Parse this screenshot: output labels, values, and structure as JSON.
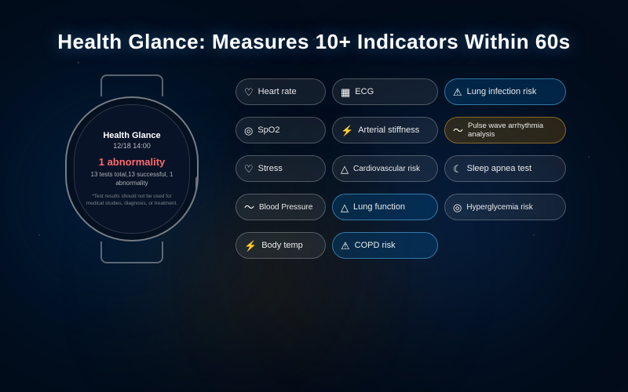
{
  "page": {
    "title": "Health Glance: Measures 10+ Indicators Within 60s"
  },
  "watch": {
    "screen_title": "Health Glance",
    "screen_date": "12/18 14:00",
    "abnormality_text": "1 abnormality",
    "count_text": "13 tests total,13 successful, 1\nabnormality",
    "disclaimer": "*Test results should not be\nused for medical studies,\ndiagnosis, or treatment."
  },
  "indicators": [
    {
      "id": "heart-rate",
      "icon": "♡",
      "label": "Heart rate",
      "style": "normal",
      "col": 1,
      "row": 1
    },
    {
      "id": "ecg",
      "icon": "📋",
      "label": "ECG",
      "style": "normal",
      "col": 2,
      "row": 1
    },
    {
      "id": "lung-infection",
      "icon": "⚠",
      "label": "Lung infection risk",
      "style": "highlighted",
      "col": 3,
      "row": 1
    },
    {
      "id": "spo2",
      "icon": "◎",
      "label": "SpO2",
      "style": "normal",
      "col": 1,
      "row": 2
    },
    {
      "id": "arterial-stiffness",
      "icon": "⚡",
      "label": "Arterial stiffness",
      "style": "normal",
      "col": 2,
      "row": 2
    },
    {
      "id": "pulse-wave",
      "icon": "〜",
      "label": "Pulse wave arrhythmia analysis",
      "style": "highlighted-orange",
      "col": 3,
      "row": 2
    },
    {
      "id": "stress",
      "icon": "♡",
      "label": "Stress",
      "style": "normal",
      "col": 1,
      "row": 3
    },
    {
      "id": "cardiovascular",
      "icon": "△",
      "label": "Cardiovascular risk",
      "style": "normal",
      "col": 2,
      "row": 3
    },
    {
      "id": "sleep-apnea",
      "icon": "☽",
      "label": "Sleep apnea test",
      "style": "normal",
      "col": 3,
      "row": 3
    },
    {
      "id": "blood-pressure",
      "icon": "〜",
      "label": "Blood Pressure",
      "style": "normal",
      "col": 1,
      "row": 4
    },
    {
      "id": "lung-function",
      "icon": "△",
      "label": "Lung function",
      "style": "highlighted",
      "col": 2,
      "row": 4
    },
    {
      "id": "hyperglycemia",
      "icon": "◎",
      "label": "Hyperglycemia risk",
      "style": "normal",
      "col": 3,
      "row": 4
    },
    {
      "id": "body-temp",
      "icon": "⚡",
      "label": "Body temp",
      "style": "normal",
      "col": 1,
      "row": 5
    },
    {
      "id": "copd-risk",
      "icon": "⚠",
      "label": "COPD risk",
      "style": "highlighted",
      "col": 2,
      "row": 5
    }
  ],
  "icons": {
    "heart": "♡",
    "ecg": "▦",
    "warning": "⚠",
    "circle": "◎",
    "wave": "〜",
    "triangle": "△",
    "moon": "☾",
    "bolt": "⚡",
    "temp": "🌡"
  }
}
